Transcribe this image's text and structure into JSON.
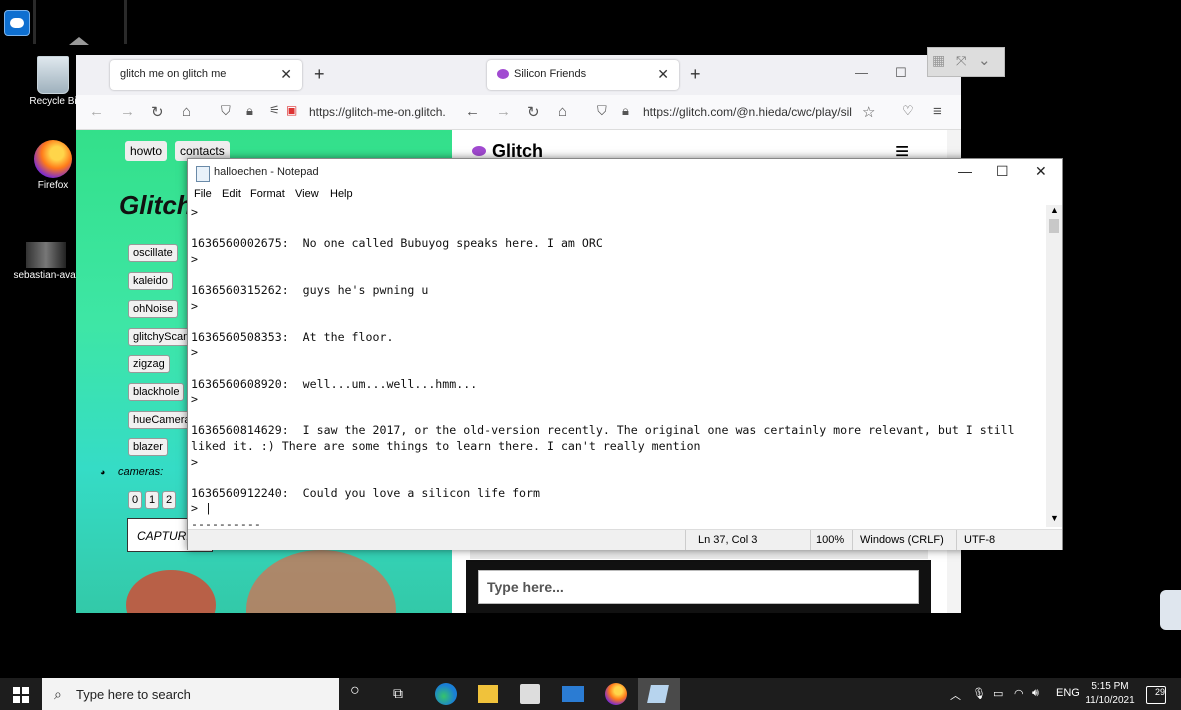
{
  "desktop": {
    "icons": [
      {
        "label": "Recycle Bi"
      },
      {
        "label": "Firefox"
      },
      {
        "label": "sebastian-avat"
      }
    ]
  },
  "browser1": {
    "tab_title": "glitch me on glitch me",
    "url": "https://glitch-me-on.glitch.",
    "page": {
      "top_links": [
        "howto",
        "contacts"
      ],
      "title": "Glitch",
      "effects": [
        "oscillate",
        "kaleido",
        "ohNoise",
        "glitchyScan",
        "zigzag",
        "blackhole",
        "hueCamera",
        "blazer"
      ],
      "cameras_label": "cameras:",
      "camera_buttons": [
        "0",
        "1",
        "2"
      ],
      "capture_label": "CAPTURE"
    }
  },
  "browser2": {
    "tab_title": "Silicon Friends",
    "url": "https://glitch.com/@n.hieda/cwc/play/sil",
    "page_header": "Glitch",
    "input_placeholder": "Type here..."
  },
  "notepad": {
    "title": "halloechen - Notepad",
    "menu": [
      "File",
      "Edit",
      "Format",
      "View",
      "Help"
    ],
    "lines": [
      ">",
      "",
      "1636560002675:  No one called Bubuyog speaks here. I am ORC",
      ">",
      "",
      "1636560315262:  guys he's pwning u",
      ">",
      "",
      "1636560508353:  At the floor.",
      ">",
      "",
      "1636560608920:  well...um...well...hmm...",
      ">",
      "",
      "1636560814629:  I saw the 2017, or the old-version recently. The original one was certainly more relevant, but I still",
      "liked it. :) There are some things to learn there. I can't really mention",
      ">",
      "",
      "1636560912240:  Could you love a silicon life form",
      "> |",
      "----------"
    ],
    "status": {
      "position": "Ln 37, Col 3",
      "zoom": "100%",
      "line_ending": "Windows (CRLF)",
      "encoding": "UTF-8"
    }
  },
  "taskbar": {
    "search_placeholder": "Type here to search",
    "language": "ENG",
    "time": "5:15 PM",
    "date": "11/10/2021",
    "notifications": "29"
  }
}
